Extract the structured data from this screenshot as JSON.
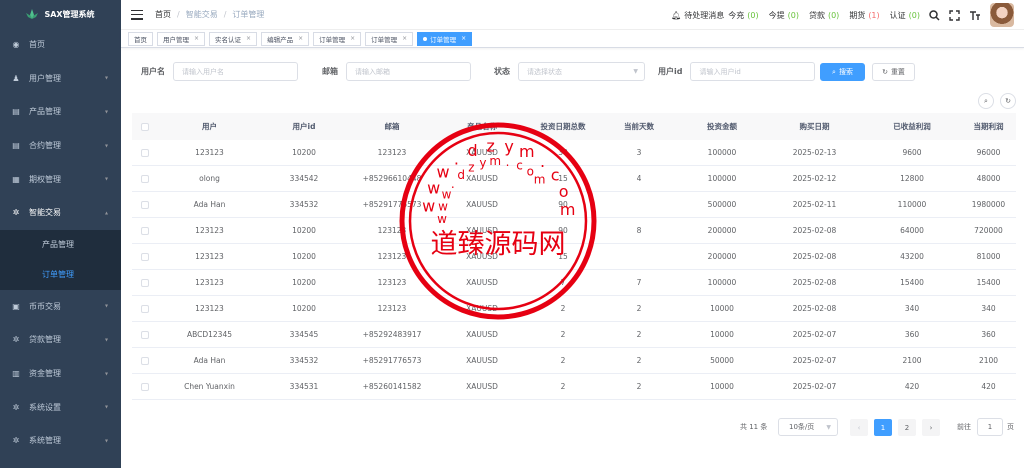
{
  "colors": {
    "sidebar": "#304156",
    "submenu": "#1f2d3d",
    "primary": "#409eff",
    "success": "#67c23a",
    "danger": "#f56c6c",
    "stamp": "#e60012"
  },
  "sidebar": {
    "logo_text": "SAX管理系统",
    "items": [
      {
        "label": "首页",
        "icon": "dashboard-icon"
      },
      {
        "label": "用户管理",
        "icon": "user-icon"
      },
      {
        "label": "产品管理",
        "icon": "document-icon"
      },
      {
        "label": "合约管理",
        "icon": "document-icon"
      },
      {
        "label": "期权管理",
        "icon": "calendar-icon"
      },
      {
        "label": "智能交易",
        "icon": "gear-icon"
      },
      {
        "label": "币币交易",
        "icon": "exchange-icon"
      },
      {
        "label": "贷款管理",
        "icon": "gear-icon"
      },
      {
        "label": "资金管理",
        "icon": "wallet-icon"
      },
      {
        "label": "系统设置",
        "icon": "gear-icon"
      },
      {
        "label": "系统管理",
        "icon": "gear-icon"
      }
    ],
    "submenu": [
      {
        "label": "产品管理"
      },
      {
        "label": "订单管理"
      }
    ]
  },
  "header": {
    "breadcrumb": [
      "首页",
      "智能交易",
      "订单管理"
    ],
    "pending_label": "待处理消息",
    "counters": [
      {
        "label": "今充",
        "value": "(0)"
      },
      {
        "label": "今提",
        "value": "(0)"
      },
      {
        "label": "贷款",
        "value": "(0)"
      },
      {
        "label": "期货",
        "value": "(1)"
      },
      {
        "label": "认证",
        "value": "(0)"
      }
    ]
  },
  "tags": [
    "首页",
    "用户管理",
    "实名认证",
    "编辑产品",
    "订单管理",
    "订单管理",
    "订单管理"
  ],
  "search": {
    "user_label": "用户名",
    "user_placeholder": "请输入用户名",
    "email_label": "邮箱",
    "email_placeholder": "请输入邮箱",
    "status_label": "状态",
    "status_placeholder": "请选择状态",
    "uid_label": "用户id",
    "uid_placeholder": "请输入用户id",
    "search_btn": "搜索",
    "reset_btn": "重置"
  },
  "table": {
    "columns": [
      "用户",
      "用户id",
      "邮箱",
      "产品名称",
      "投资日期总数",
      "当前天数",
      "投资金额",
      "购买日期",
      "已收益利润",
      "当期利润"
    ],
    "rows": [
      [
        "123123",
        "10200",
        "123123",
        "XAUUSD",
        "30",
        "3",
        "100000",
        "2025-02-13",
        "9600",
        "96000"
      ],
      [
        "olong",
        "334542",
        "+85296610448",
        "XAUUSD",
        "15",
        "4",
        "100000",
        "2025-02-12",
        "12800",
        "48000"
      ],
      [
        "Ada Han",
        "334532",
        "+85291776573",
        "XAUUSD",
        "90",
        "",
        "500000",
        "2025-02-11",
        "110000",
        "1980000"
      ],
      [
        "123123",
        "10200",
        "123123",
        "XAUUSD",
        "90",
        "8",
        "200000",
        "2025-02-08",
        "64000",
        "720000"
      ],
      [
        "123123",
        "10200",
        "123123",
        "XAUUSD",
        "15",
        "",
        "200000",
        "2025-02-08",
        "43200",
        "81000"
      ],
      [
        "123123",
        "10200",
        "123123",
        "XAUUSD",
        "7",
        "7",
        "100000",
        "2025-02-08",
        "15400",
        "15400"
      ],
      [
        "123123",
        "10200",
        "123123",
        "XAUUSD",
        "2",
        "2",
        "10000",
        "2025-02-08",
        "340",
        "340"
      ],
      [
        "ABCD12345",
        "334545",
        "+85292483917",
        "XAUUSD",
        "2",
        "2",
        "10000",
        "2025-02-07",
        "360",
        "360"
      ],
      [
        "Ada Han",
        "334532",
        "+85291776573",
        "XAUUSD",
        "2",
        "2",
        "50000",
        "2025-02-07",
        "2100",
        "2100"
      ],
      [
        "Chen Yuanxin",
        "334531",
        "+85260141582",
        "XAUUSD",
        "2",
        "2",
        "10000",
        "2025-02-07",
        "420",
        "420"
      ]
    ]
  },
  "pagination": {
    "total": "共 11 条",
    "page_size": "10条/页",
    "pages": [
      "1",
      "2"
    ],
    "prev": "‹",
    "next": "›",
    "goto_label": "前往",
    "goto_value": "1",
    "page_suffix": "页"
  },
  "watermark": {
    "text": "道臻源码网",
    "url": "www.dzym.com"
  }
}
